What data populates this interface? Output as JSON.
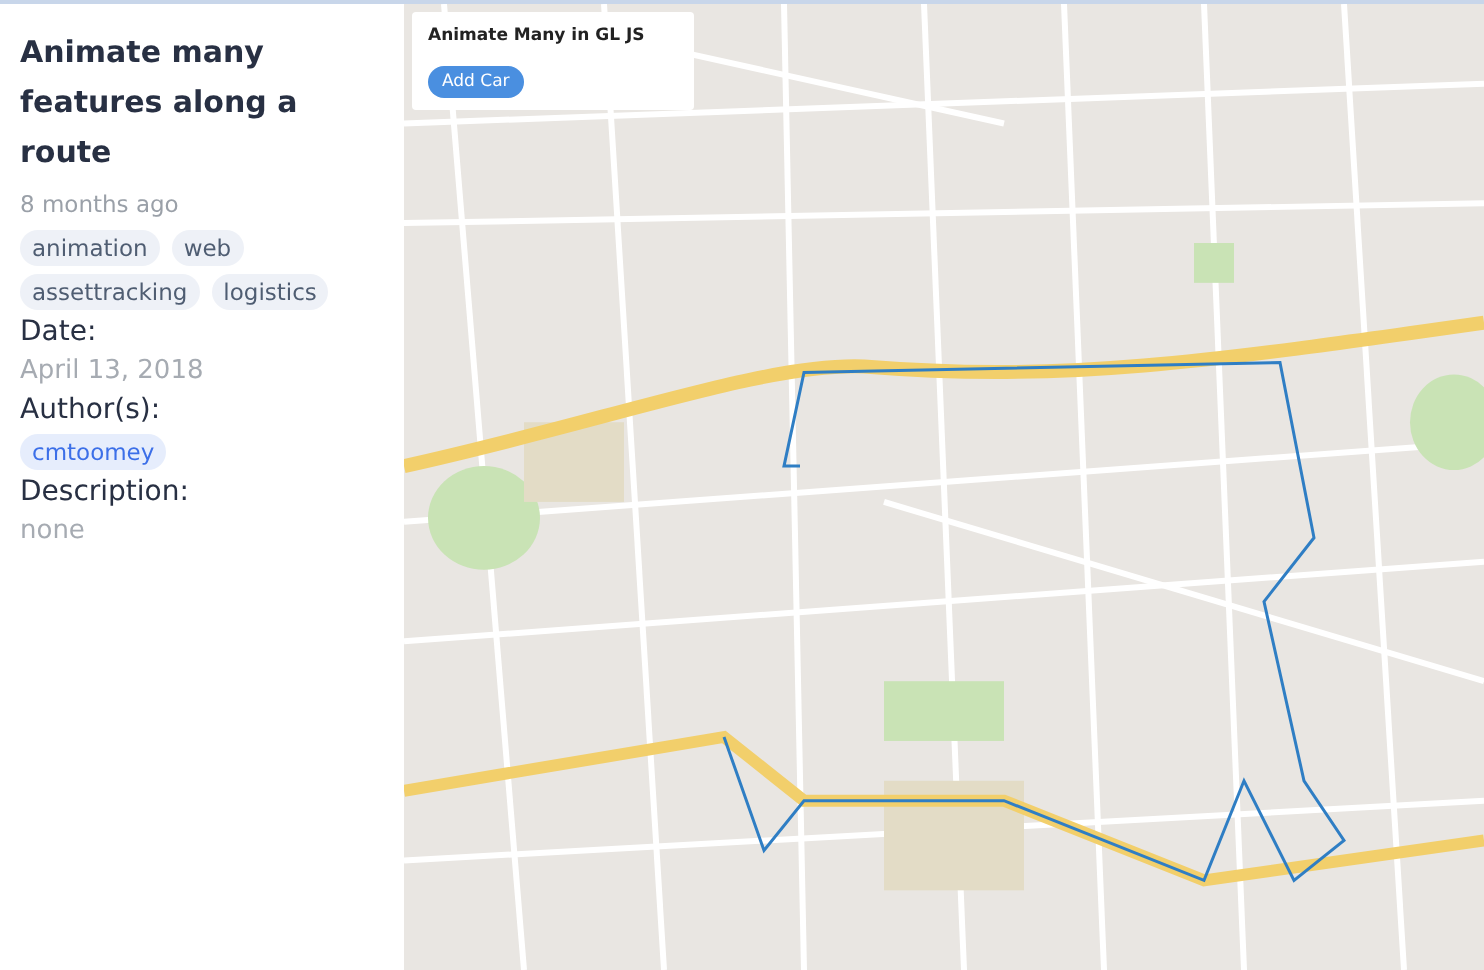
{
  "sidebar": {
    "title": "Animate many features along a route",
    "age": "8 months ago",
    "tags": [
      "animation",
      "web",
      "assettracking",
      "logistics"
    ],
    "date_label": "Date:",
    "date": "April 13, 2018",
    "authors_label": "Author(s):",
    "authors": [
      "cmtoomey"
    ],
    "description_label": "Description:",
    "description": "none"
  },
  "map": {
    "panel": {
      "title": "Animate Many in GL JS",
      "button": "Add Car"
    }
  }
}
